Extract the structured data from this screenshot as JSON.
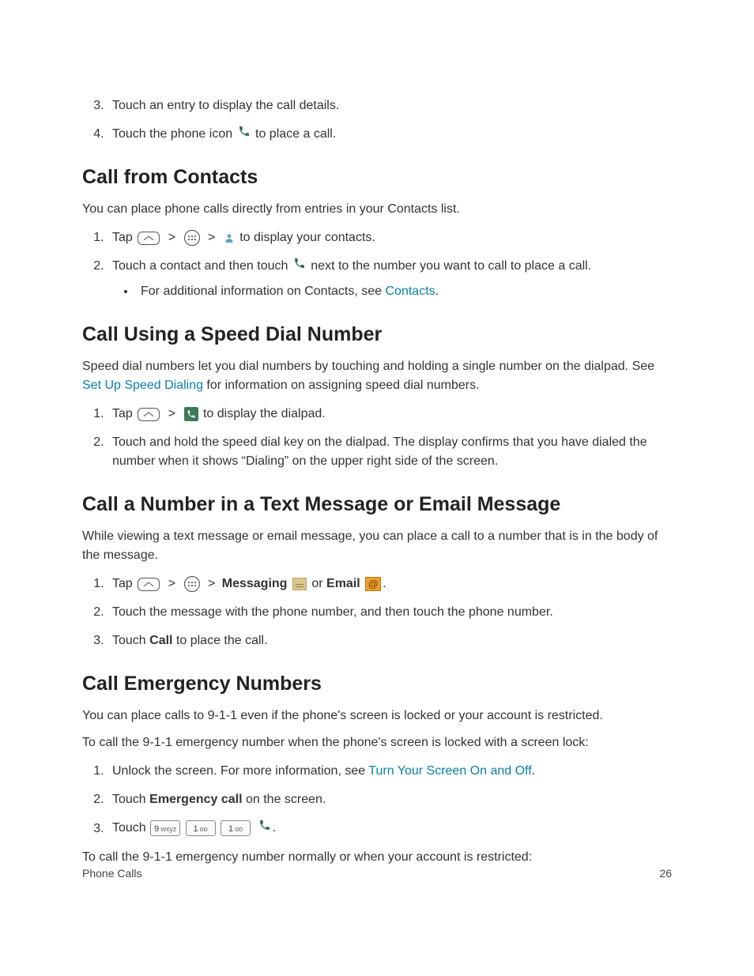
{
  "toplist": {
    "item3": "Touch an entry to display the call details.",
    "item4_a": "Touch the phone icon ",
    "item4_b": " to place a call."
  },
  "s1": {
    "heading": "Call from Contacts",
    "intro": "You can place phone calls directly from entries in your Contacts list.",
    "li1_a": "Tap ",
    "li1_b": " to display your contacts.",
    "li2_a": "Touch a contact and then touch ",
    "li2_b": " next to the number you want to call to place a call.",
    "sub_a": "For additional information on Contacts, see ",
    "sub_link": "Contacts",
    "sub_b": "."
  },
  "s2": {
    "heading": "Call Using a Speed Dial Number",
    "intro_a": "Speed dial numbers let you dial numbers by touching and holding a single number on the dialpad. See ",
    "intro_link": "Set Up Speed Dialing",
    "intro_b": " for information on assigning speed dial numbers.",
    "li1_a": "Tap ",
    "li1_b": " to display the dialpad.",
    "li2": "Touch and hold the speed dial key on the dialpad. The display confirms that you have dialed the number when it shows “Dialing” on the upper right side of the screen."
  },
  "s3": {
    "heading": "Call a Number in a Text Message or Email Message",
    "intro": "While viewing a text message or email message, you can place a call to a number that is in the body of the message.",
    "li1_a": "Tap ",
    "li1_msg": "Messaging",
    "li1_or": " or ",
    "li1_email": "Email",
    "li1_end": ".",
    "li2": "Touch the message with the phone number, and then touch the phone number.",
    "li3_a": "Touch ",
    "li3_bold": "Call",
    "li3_b": " to place the call."
  },
  "s4": {
    "heading": "Call Emergency Numbers",
    "p1": "You can place calls to 9-1-1 even if the phone's screen is locked or your account is restricted.",
    "p2": "To call the 9-1-1 emergency number when the phone's screen is locked with a screen lock:",
    "li1_a": "Unlock the screen. For more information, see ",
    "li1_link": "Turn Your Screen On and Off",
    "li1_b": ".",
    "li2_a": "Touch ",
    "li2_bold": "Emergency call",
    "li2_b": " on the screen.",
    "li3_a": "Touch ",
    "li3_b": ".",
    "key9": "9",
    "key9sub": "wxyz",
    "key1": "1",
    "key1sub": "oo",
    "p3": "To call the 9-1-1 emergency number normally or when your account is restricted:"
  },
  "footer": {
    "section": "Phone Calls",
    "page": "26"
  },
  "gt": ">"
}
